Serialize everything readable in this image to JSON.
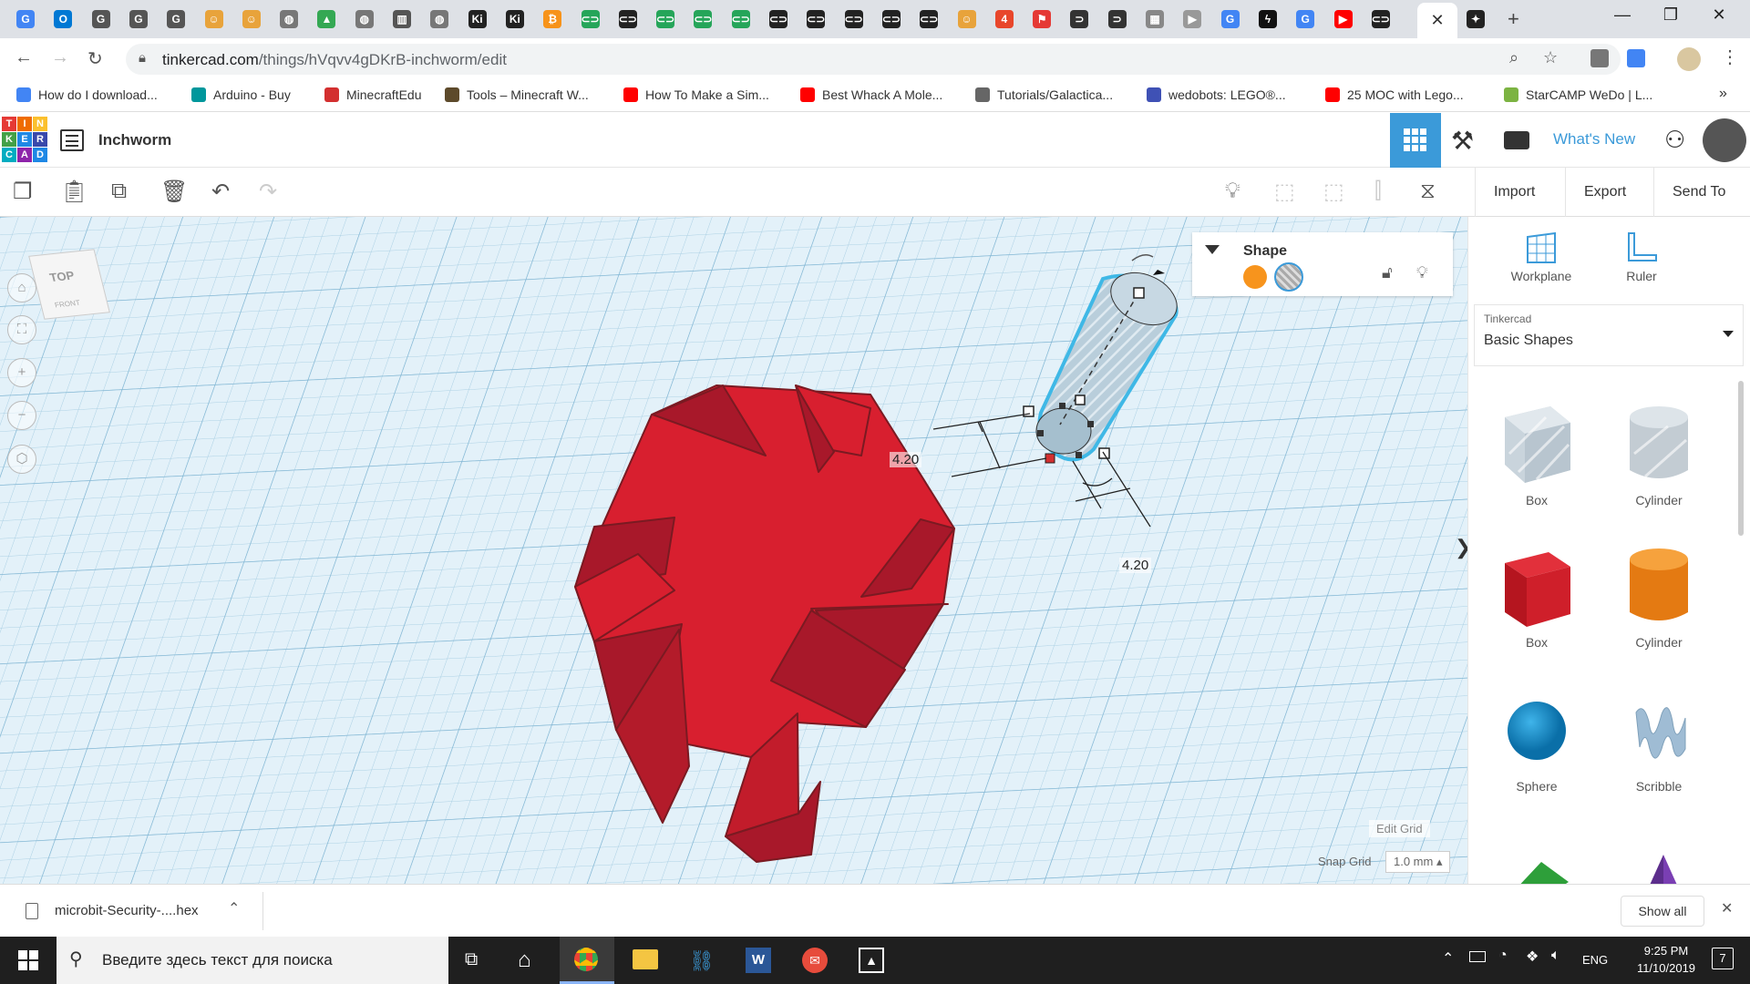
{
  "browser": {
    "active_tab_close": "✕",
    "new_tab": "+",
    "tabs": [
      {
        "icon": "google-docs-icon",
        "color": "#4285f4",
        "glyph": "G"
      },
      {
        "icon": "outlook-icon",
        "color": "#0078d4",
        "glyph": "O"
      },
      {
        "icon": "classroom-icon",
        "color": "#555555",
        "glyph": "G"
      },
      {
        "icon": "classroom-icon",
        "color": "#555555",
        "glyph": "G"
      },
      {
        "icon": "classroom-icon",
        "color": "#555555",
        "glyph": "G"
      },
      {
        "icon": "emoji-icon",
        "color": "#e8a33b",
        "glyph": "☺"
      },
      {
        "icon": "emoji-icon",
        "color": "#e8a33b",
        "glyph": "☺"
      },
      {
        "icon": "globe-icon",
        "color": "#777777",
        "glyph": "◍"
      },
      {
        "icon": "drive-icon",
        "color": "#34a853",
        "glyph": "▲"
      },
      {
        "icon": "globe-icon",
        "color": "#777777",
        "glyph": "◍"
      },
      {
        "icon": "book-icon",
        "color": "#555555",
        "glyph": "▥"
      },
      {
        "icon": "globe-icon",
        "color": "#777777",
        "glyph": "◍"
      },
      {
        "icon": "ki-icon",
        "color": "#222222",
        "glyph": "Ki"
      },
      {
        "icon": "ki-icon",
        "color": "#222222",
        "glyph": "Ki"
      },
      {
        "icon": "bitcoin-icon",
        "color": "#f7931a",
        "glyph": "₿"
      },
      {
        "icon": "makecode-icon",
        "color": "#25a559",
        "glyph": "⊂⊃"
      },
      {
        "icon": "makecode-icon",
        "color": "#222222",
        "glyph": "⊂⊃"
      },
      {
        "icon": "makecode-icon",
        "color": "#25a559",
        "glyph": "⊂⊃"
      },
      {
        "icon": "makecode-icon",
        "color": "#25a559",
        "glyph": "⊂⊃"
      },
      {
        "icon": "makecode-icon",
        "color": "#25a559",
        "glyph": "⊂⊃"
      },
      {
        "icon": "makecode-icon",
        "color": "#222222",
        "glyph": "⊂⊃"
      },
      {
        "icon": "makecode-icon",
        "color": "#222222",
        "glyph": "⊂⊃"
      },
      {
        "icon": "makecode-icon",
        "color": "#222222",
        "glyph": "⊂⊃"
      },
      {
        "icon": "makecode-icon",
        "color": "#222222",
        "glyph": "⊂⊃"
      },
      {
        "icon": "makecode-icon",
        "color": "#222222",
        "glyph": "⊂⊃"
      },
      {
        "icon": "emoji-icon",
        "color": "#e8a33b",
        "glyph": "☺"
      },
      {
        "icon": "four-icon",
        "color": "#e8462b",
        "glyph": "4"
      },
      {
        "icon": "flag-icon",
        "color": "#e53935",
        "glyph": "⚑"
      },
      {
        "icon": "link-icon",
        "color": "#333333",
        "glyph": "⊃"
      },
      {
        "icon": "link-icon",
        "color": "#333333",
        "glyph": "⊃"
      },
      {
        "icon": "grid-icon",
        "color": "#888888",
        "glyph": "▦"
      },
      {
        "icon": "youtube-icon",
        "color": "#999999",
        "glyph": "▶"
      },
      {
        "icon": "google-icon",
        "color": "#4285f4",
        "glyph": "G"
      },
      {
        "icon": "bolt-icon",
        "color": "#111111",
        "glyph": "ϟ"
      },
      {
        "icon": "google-icon",
        "color": "#4285f4",
        "glyph": "G"
      },
      {
        "icon": "youtube-icon",
        "color": "#ff0000",
        "glyph": "▶"
      },
      {
        "icon": "makecode-icon",
        "color": "#222222",
        "glyph": "⊂⊃"
      }
    ],
    "extra_tab_icon": "star-badge-icon",
    "url_host": "tinkercad.com",
    "url_path": "/things/hVqvv4gDKrB-inchworm/edit",
    "bookmarks": [
      {
        "label": "How do I download...",
        "color": "#4285f4"
      },
      {
        "label": "Arduino - Buy",
        "color": "#00979c"
      },
      {
        "label": "MinecraftEdu",
        "color": "#d32f2f"
      },
      {
        "label": "Tools – Minecraft W...",
        "color": "#5d4a2b"
      },
      {
        "label": "How To Make a Sim...",
        "color": "#ff0000"
      },
      {
        "label": "Best Whack A Mole...",
        "color": "#ff0000"
      },
      {
        "label": "Tutorials/Galactica...",
        "color": "#666666"
      },
      {
        "label": "wedobots: LEGO®...",
        "color": "#3f51b5"
      },
      {
        "label": "25 MOC with Lego...",
        "color": "#ff0000"
      },
      {
        "label": "StarCAMP WeDo | L...",
        "color": "#7cb342"
      }
    ],
    "bookmarks_more": "»"
  },
  "tinkercad": {
    "logo_letters": [
      "T",
      "I",
      "N",
      "K",
      "E",
      "R",
      "C",
      "A",
      "D"
    ],
    "logo_colors": [
      "#e53935",
      "#ef6c00",
      "#fbc02d",
      "#43a047",
      "#1e88e5",
      "#3949ab",
      "#00acc1",
      "#8e24aa",
      "#1e88e5"
    ],
    "design_title": "Inchworm",
    "whats_new": "What's New"
  },
  "toolbar": {
    "import": "Import",
    "export": "Export",
    "send_to": "Send To"
  },
  "viewcube": {
    "top": "TOP",
    "front": "FRONT"
  },
  "shape_panel": {
    "title": "Shape",
    "solid_color": "#f7941d"
  },
  "dimensions": {
    "height_label": "4.20",
    "width_label": "4.20"
  },
  "grid_controls": {
    "edit_grid": "Edit Grid",
    "snap_grid_label": "Snap Grid",
    "snap_grid_value": "1.0 mm ▴"
  },
  "right_panel": {
    "workplane": "Workplane",
    "ruler": "Ruler",
    "library_category": "Tinkercad",
    "library_name": "Basic Shapes",
    "pieces": [
      {
        "label": "Box",
        "kind": "hole-box"
      },
      {
        "label": "Cylinder",
        "kind": "hole-cylinder"
      },
      {
        "label": "Box",
        "kind": "box"
      },
      {
        "label": "Cylinder",
        "kind": "cylinder"
      },
      {
        "label": "Sphere",
        "kind": "sphere"
      },
      {
        "label": "Scribble",
        "kind": "scribble"
      }
    ]
  },
  "download_bar": {
    "filename": "microbit-Security-....hex",
    "show_all": "Show all"
  },
  "taskbar": {
    "search_placeholder": "Введите здесь текст для поиска",
    "language": "ENG",
    "time": "9:25 PM",
    "date": "11/10/2019",
    "notifications": "7"
  }
}
